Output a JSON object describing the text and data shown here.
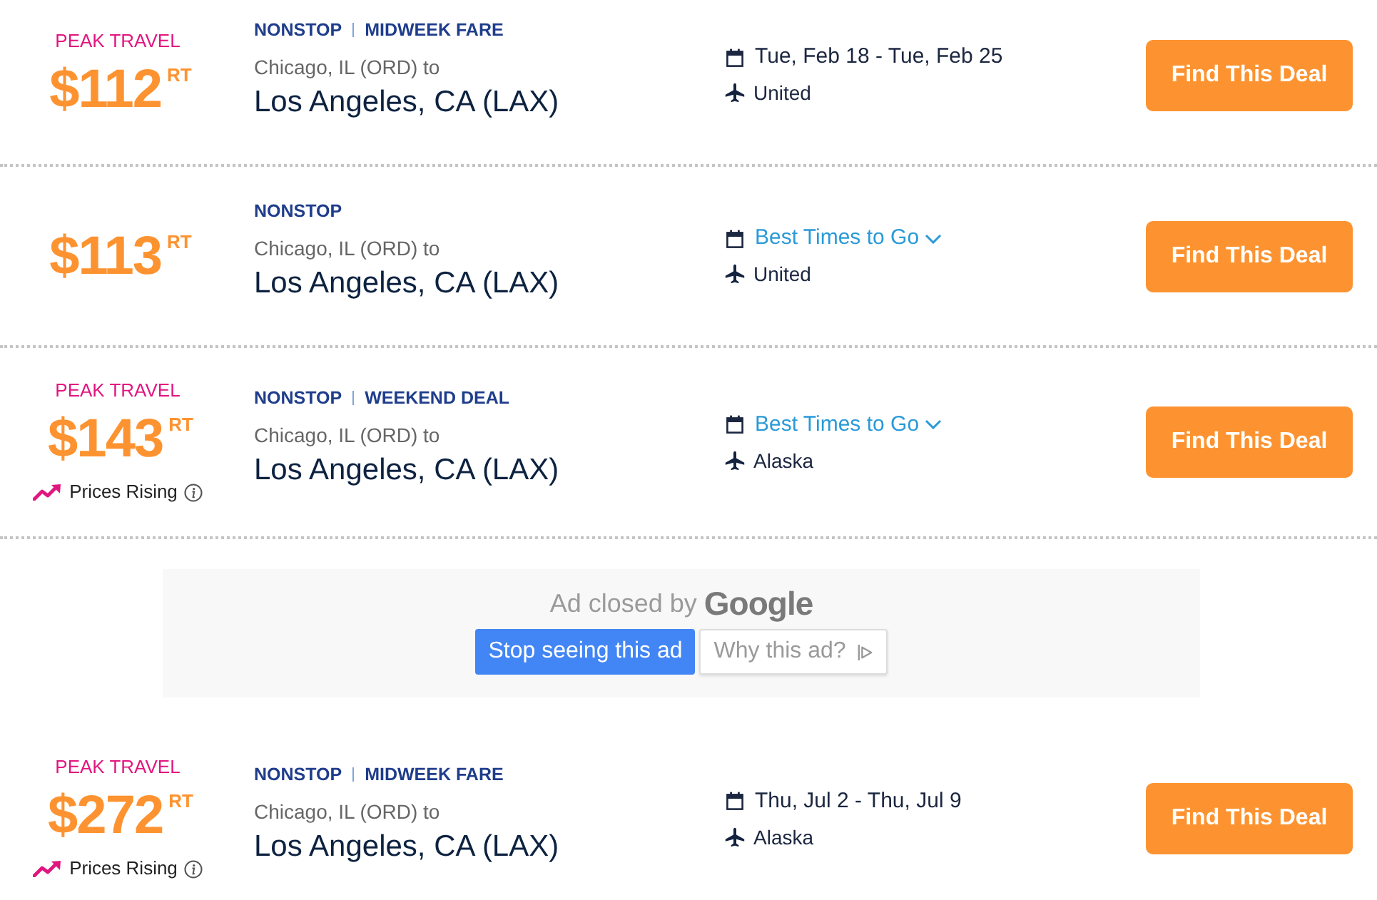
{
  "listings": [
    {
      "kind": "deal",
      "peak_label": "PEAK TRAVEL",
      "price": "$112",
      "price_unit": "RT",
      "tags": [
        "NONSTOP",
        "MIDWEEK FARE"
      ],
      "origin": "Chicago, IL (ORD) to",
      "destination": "Los Angeles, CA (LAX)",
      "dates": {
        "kind": "range",
        "text": "Tue, Feb 18 - Tue, Feb 25"
      },
      "airline": "United",
      "button": "Find This Deal"
    },
    {
      "kind": "deal",
      "price": "$113",
      "price_unit": "RT",
      "tags": [
        "NONSTOP"
      ],
      "origin": "Chicago, IL (ORD) to",
      "destination": "Los Angeles, CA (LAX)",
      "dates": {
        "kind": "dropdown",
        "text": "Best Times to Go"
      },
      "airline": "United",
      "button": "Find This Deal"
    },
    {
      "kind": "deal",
      "peak_label": "PEAK TRAVEL",
      "price": "$143",
      "price_unit": "RT",
      "trend": "Prices Rising",
      "tags": [
        "NONSTOP",
        "WEEKEND DEAL"
      ],
      "origin": "Chicago, IL (ORD) to",
      "destination": "Los Angeles, CA (LAX)",
      "dates": {
        "kind": "dropdown",
        "text": "Best Times to Go"
      },
      "airline": "Alaska",
      "button": "Find This Deal"
    },
    {
      "kind": "ad",
      "text": "Ad closed by",
      "brand": "Google",
      "buttons": [
        {
          "kind": "primary",
          "label": "Stop seeing this ad"
        },
        {
          "kind": "secondary",
          "label": "Why this ad?"
        }
      ]
    },
    {
      "kind": "deal",
      "peak_label": "PEAK TRAVEL",
      "price": "$272",
      "price_unit": "RT",
      "trend": "Prices Rising",
      "tags": [
        "NONSTOP",
        "MIDWEEK FARE"
      ],
      "origin": "Chicago, IL (ORD) to",
      "destination": "Los Angeles, CA (LAX)",
      "dates": {
        "kind": "range",
        "text": "Thu, Jul 2 - Thu, Jul 9"
      },
      "airline": "Alaska",
      "button": "Find This Deal"
    }
  ]
}
